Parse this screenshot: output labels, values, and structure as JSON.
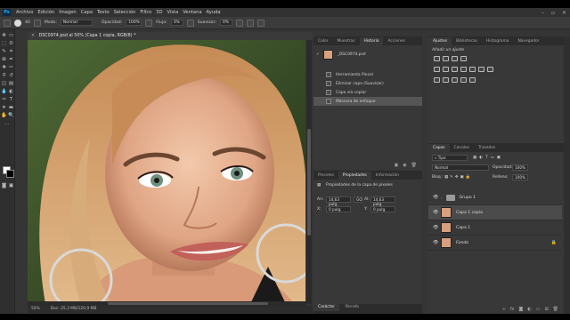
{
  "menu": {
    "items": [
      "Archivo",
      "Edición",
      "Imagen",
      "Capa",
      "Texto",
      "Selección",
      "Filtro",
      "3D",
      "Vista",
      "Ventana",
      "Ayuda"
    ]
  },
  "options": {
    "mode_label": "Modo:",
    "mode_value": "Normal",
    "opacity_label": "Opacidad:",
    "opacity_value": "100%",
    "flow_label": "Flujo:",
    "flow_value": "3%",
    "smoothing_label": "Suavizar:",
    "smoothing_value": "0%",
    "brush_size": "40"
  },
  "document": {
    "tab_title": "DSC0974.psd al 50% (Capa 1 copia, RGB/8) *",
    "zoom": "50%",
    "doc_info": "Doc: 25,3 MB/120,9 MB"
  },
  "history": {
    "tabs": [
      "Color",
      "Muestras",
      "Historia",
      "Acciones"
    ],
    "snapshot": "_DSC0974.psd",
    "steps": [
      "Herramienta Pincel",
      "Eliminar capa (Suavizar)",
      "Capa vía copiar",
      "Máscara de enfoque"
    ]
  },
  "properties": {
    "tabs": [
      "Pinceles",
      "Propiedades",
      "Información"
    ],
    "heading": "Propiedades de la capa de píxeles",
    "w_label": "An:",
    "w_value": "14,63 pulg.",
    "link": "GO",
    "h_label": "Al:",
    "h_value": "14,63 pulg.",
    "x_label": "X:",
    "x_value": "0 pulg.",
    "y_label": "Y:",
    "y_value": "0 pulg."
  },
  "adjustments": {
    "tabs": [
      "Ajustes",
      "Bibliotecas",
      "Histograma",
      "Navegador"
    ],
    "add_label": "Añadir un ajuste"
  },
  "layers": {
    "tabs": [
      "Capas",
      "Canales",
      "Trazados"
    ],
    "filter_label": "Tipo",
    "blend_mode": "Normal",
    "opacity_label": "Opacidad:",
    "opacity_value": "100%",
    "lock_label": "Bloq.:",
    "fill_label": "Relleno:",
    "fill_value": "100%",
    "rows": [
      {
        "name": "Grupo 1",
        "kind": "group"
      },
      {
        "name": "Capa 1 copia",
        "kind": "layer",
        "selected": true
      },
      {
        "name": "Capa 1",
        "kind": "layer"
      },
      {
        "name": "Fondo",
        "kind": "background"
      }
    ]
  },
  "bottom_left": {
    "tabs": [
      "Carácter",
      "Párrafo"
    ]
  },
  "colors": {
    "foreground": "#ffffff",
    "background": "#000000",
    "panel": "#383838",
    "accent": "#31a8ff"
  }
}
